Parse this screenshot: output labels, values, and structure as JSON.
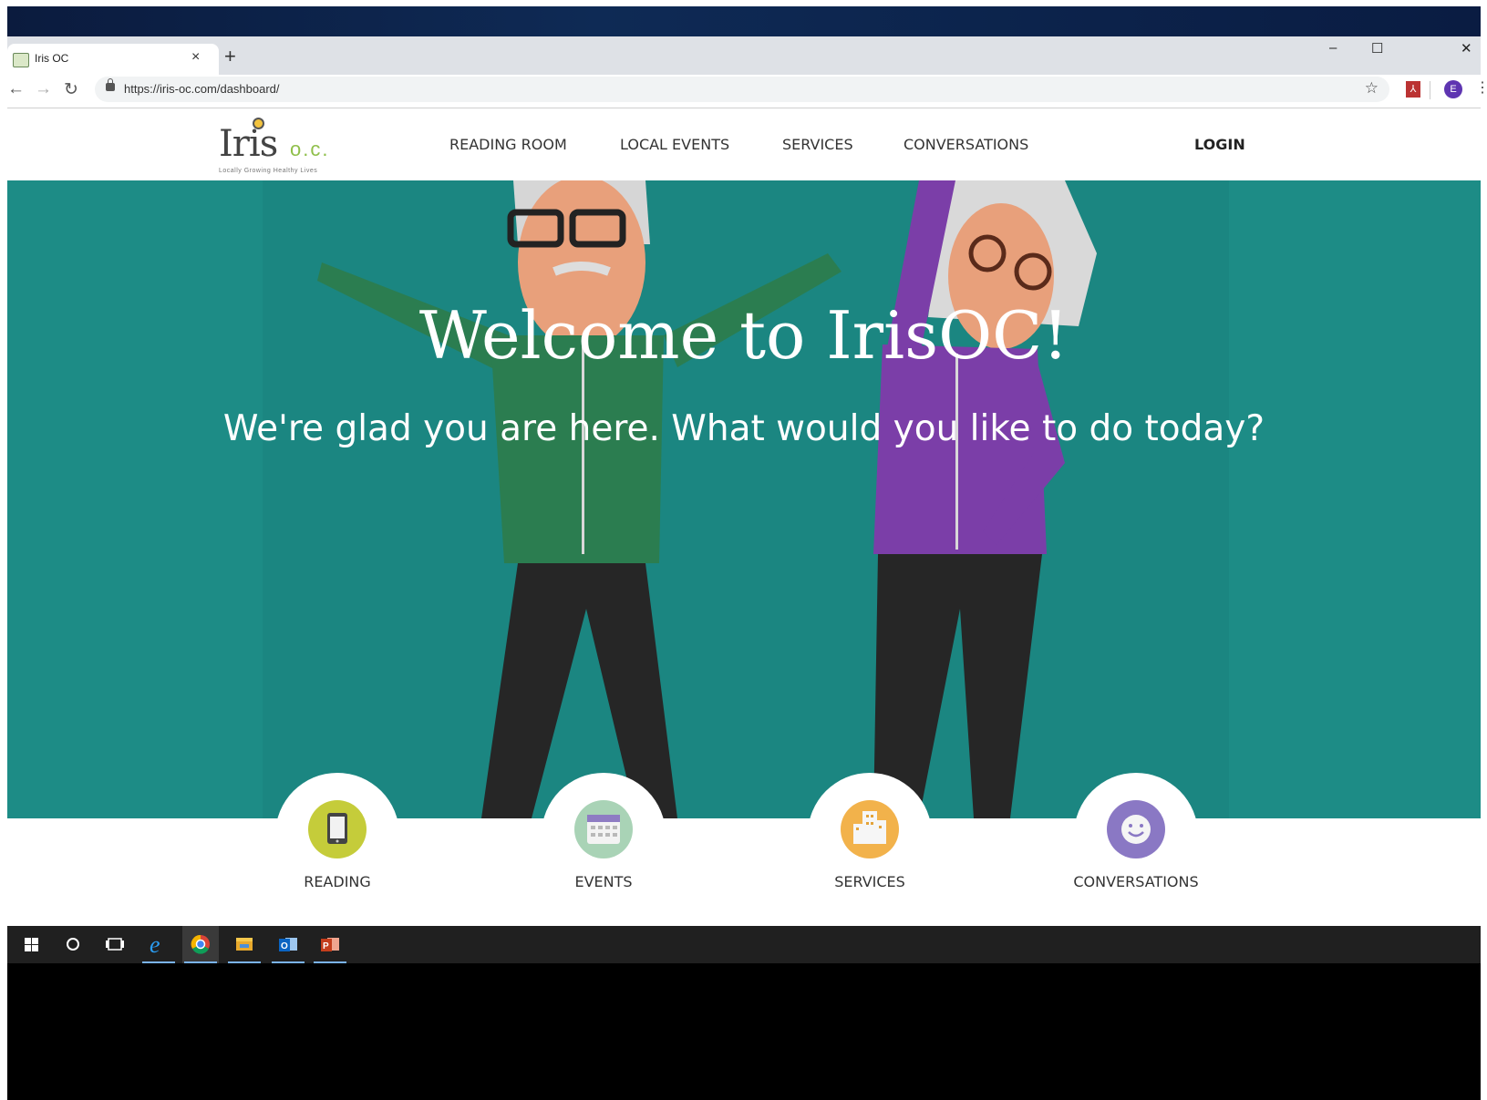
{
  "browser": {
    "tab_title": "Iris OC",
    "tab_close": "×",
    "new_tab": "+",
    "minimize": "–",
    "maximize": "☐",
    "close": "✕",
    "back": "←",
    "forward": "→",
    "reload": "↻",
    "url": "https://iris-oc.com/dashboard/",
    "star": "☆",
    "profile_initial": "E",
    "menu": "⋮"
  },
  "site": {
    "logo_word": "Iris",
    "logo_oc": "o.c.",
    "logo_tagline": "Locally Growing Healthy Lives",
    "nav": [
      {
        "label": "READING ROOM"
      },
      {
        "label": "LOCAL EVENTS"
      },
      {
        "label": "SERVICES"
      },
      {
        "label": "CONVERSATIONS"
      }
    ],
    "login_label": "LOGIN"
  },
  "hero": {
    "title": "Welcome to IrisOC!",
    "subtitle": "We're glad you are here. What would you like to do today?"
  },
  "features": [
    {
      "label": "READING",
      "icon": "tablet-icon",
      "color": "#c5cc3a"
    },
    {
      "label": "EVENTS",
      "icon": "calendar-icon",
      "color": "#a9d3b6"
    },
    {
      "label": "SERVICES",
      "icon": "building-icon",
      "color": "#f2b24b"
    },
    {
      "label": "CONVERSATIONS",
      "icon": "smiley-icon",
      "color": "#8a78c4"
    }
  ],
  "colors": {
    "hero_teal": "#1d8c86",
    "taskbar": "#202020"
  }
}
